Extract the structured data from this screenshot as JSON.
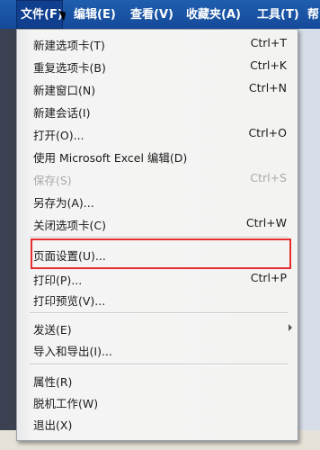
{
  "menubar": {
    "items": [
      {
        "label": "文件(F)"
      },
      {
        "label": "编辑(E)"
      },
      {
        "label": "查看(V)"
      },
      {
        "label": "收藏夹(A)"
      },
      {
        "label": "工具(T)"
      },
      {
        "label": "帮"
      }
    ]
  },
  "file_menu": {
    "items": [
      {
        "label": "新建选项卡(T)",
        "shortcut": "Ctrl+T"
      },
      {
        "label": "重复选项卡(B)",
        "shortcut": "Ctrl+K"
      },
      {
        "label": "新建窗口(N)",
        "shortcut": "Ctrl+N"
      },
      {
        "label": "新建会话(I)",
        "shortcut": ""
      },
      {
        "label": "打开(O)...",
        "shortcut": "Ctrl+O"
      },
      {
        "label": "使用 Microsoft Excel 编辑(D)",
        "shortcut": ""
      },
      {
        "label": "保存(S)",
        "shortcut": "Ctrl+S"
      },
      {
        "label": "另存为(A)...",
        "shortcut": ""
      },
      {
        "label": "关闭选项卡(C)",
        "shortcut": "Ctrl+W"
      },
      {
        "label": "页面设置(U)...",
        "shortcut": ""
      },
      {
        "label": "打印(P)...",
        "shortcut": "Ctrl+P"
      },
      {
        "label": "打印预览(V)...",
        "shortcut": ""
      },
      {
        "label": "发送(E)",
        "shortcut": ""
      },
      {
        "label": "导入和导出(I)...",
        "shortcut": ""
      },
      {
        "label": "属性(R)",
        "shortcut": ""
      },
      {
        "label": "脱机工作(W)",
        "shortcut": ""
      },
      {
        "label": "退出(X)",
        "shortcut": ""
      }
    ]
  },
  "colors": {
    "menubar": "#1f5fae",
    "menu_background": "#f3f3f2",
    "highlight_border": "#e52d2d",
    "disabled_text": "#a9a9a9"
  }
}
